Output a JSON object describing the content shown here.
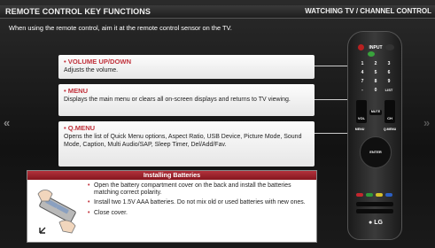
{
  "header": {
    "title": "REMOTE CONTROL KEY FUNCTIONS",
    "section": "WATCHING TV / CHANNEL CONTROL"
  },
  "intro": "When using the remote control, aim it at the remote control sensor on the TV.",
  "nav": {
    "prev": "«",
    "next": "»"
  },
  "functions": [
    {
      "head": "VOLUME UP/DOWN",
      "desc": "Adjusts the volume."
    },
    {
      "head": "MENU",
      "desc": "Displays the main menu or clears all on-screen displays and returns to TV viewing."
    },
    {
      "head": "Q.MENU",
      "desc": "Opens the list of Quick Menu options, Aspect Ratio, USB Device, Picture Mode, Sound Mode, Caption, Multi Audio/SAP, Sleep Timer, Del/Add/Fav."
    }
  ],
  "batteries": {
    "title": "Installing Batteries",
    "steps": [
      "Open the battery compartment cover on the back and install the batteries matching correct polarity.",
      "Install two 1.5V AAA batteries. Do not mix old or used batteries with new ones.",
      "Close cover."
    ]
  },
  "remote": {
    "labels": {
      "power_row": "INPUT",
      "num": [
        "1",
        "2",
        "3",
        "4",
        "5",
        "6",
        "7",
        "8",
        "9",
        "-",
        "0",
        "LIST"
      ],
      "vol": "VOL",
      "ch": "CH",
      "mute": "MUTE",
      "fav": "FAV",
      "menu": "MENU",
      "qmenu": "Q.MENU",
      "enter": "ENTER",
      "brand": "LG"
    }
  },
  "colors": {
    "accent": "#c0303a",
    "header_bar": "#2b2b2b",
    "card_bg": "#f2f2f2",
    "battery_header": "#9e2229"
  }
}
